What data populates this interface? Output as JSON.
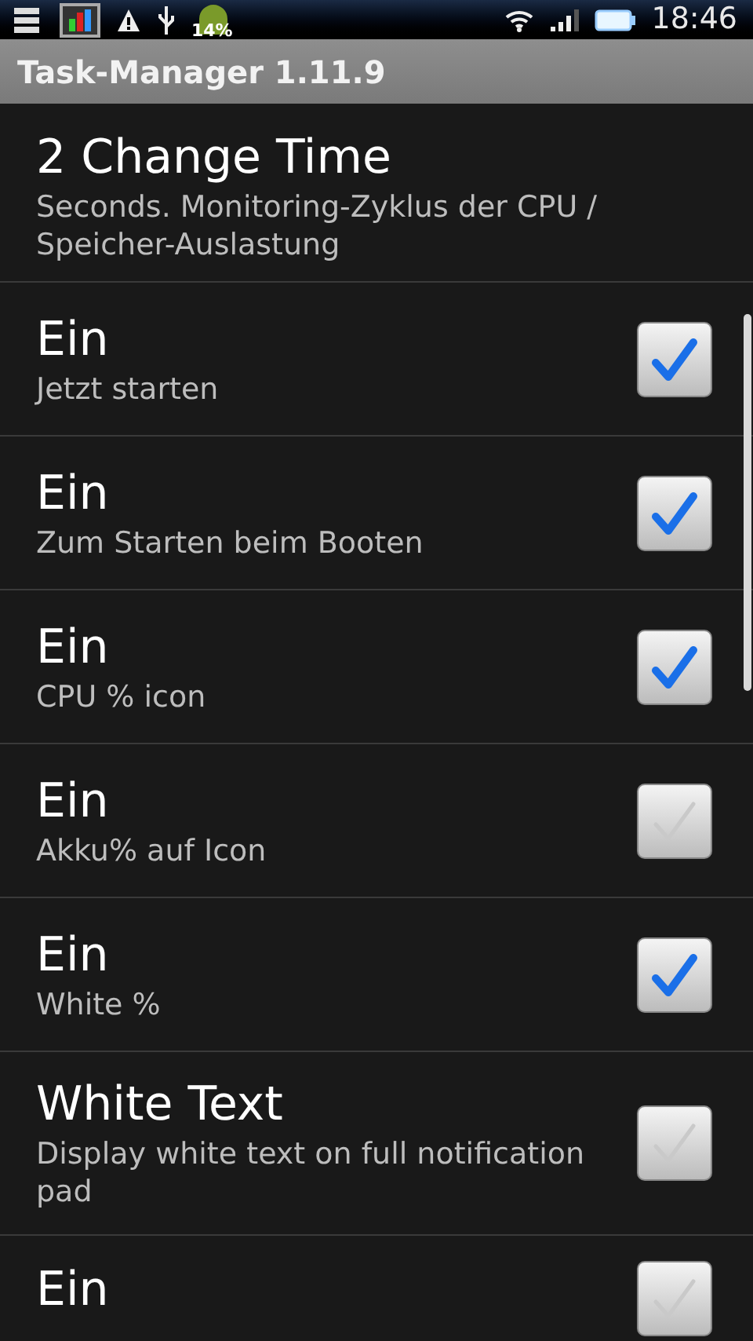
{
  "status_bar": {
    "battery_badge": "14%",
    "time": "18:46"
  },
  "title_bar": {
    "title": "Task-Manager 1.11.9"
  },
  "settings": [
    {
      "kind": "plain",
      "title": "2 Change Time",
      "summary": "Seconds. Monitoring-Zyklus der CPU / Speicher-Auslastung"
    },
    {
      "kind": "checkbox",
      "title": "Ein",
      "summary": "Jetzt starten",
      "checked": true
    },
    {
      "kind": "checkbox",
      "title": "Ein",
      "summary": "Zum Starten beim Booten",
      "checked": true
    },
    {
      "kind": "checkbox",
      "title": "Ein",
      "summary": "CPU % icon",
      "checked": true
    },
    {
      "kind": "checkbox",
      "title": "Ein",
      "summary": "Akku% auf Icon",
      "checked": false
    },
    {
      "kind": "checkbox",
      "title": "Ein",
      "summary": "White %",
      "checked": true
    },
    {
      "kind": "checkbox",
      "title": "White Text",
      "summary": "Display white text on full notification pad",
      "checked": false
    },
    {
      "kind": "checkbox",
      "title": "Ein",
      "checked": false
    }
  ]
}
